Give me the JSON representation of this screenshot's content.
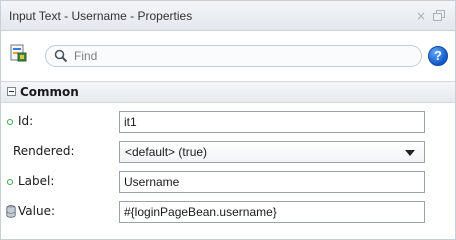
{
  "window": {
    "title": "Input Text - Username - Properties",
    "close_glyph": "×"
  },
  "toolbar": {
    "doc_icon": "document-properties-icon",
    "search_placeholder": "Find",
    "help_glyph": "?"
  },
  "section": {
    "title": "Common",
    "expanded": true
  },
  "properties": [
    {
      "label": "Id:",
      "value": "it1",
      "marker": "green-dot",
      "type": "text"
    },
    {
      "label": "Rendered:",
      "value": "<default> (true)",
      "marker": "none",
      "type": "select"
    },
    {
      "label": "Label:",
      "value": "Username",
      "marker": "green-dot",
      "type": "text"
    },
    {
      "label": "Value:",
      "value": "#{loginPageBean.username}",
      "marker": "database-icon",
      "type": "text"
    }
  ],
  "colors": {
    "help_blue": "#1a63d1",
    "dot_green": "#3da34a",
    "field_border": "#9aa3ad"
  }
}
